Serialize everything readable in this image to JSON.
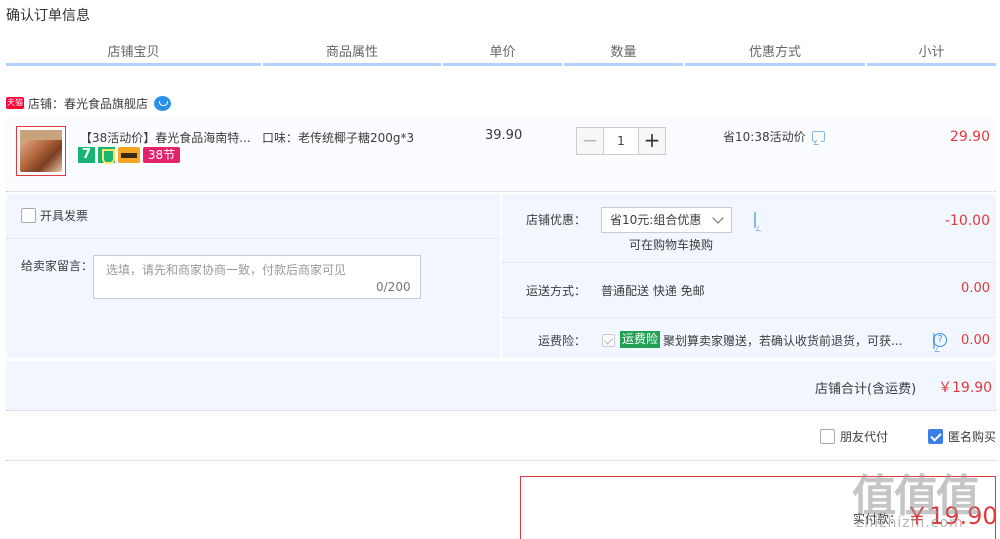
{
  "page": {
    "title": "确认订单信息"
  },
  "columns": [
    {
      "label": "店铺宝贝"
    },
    {
      "label": "商品属性"
    },
    {
      "label": "单价"
    },
    {
      "label": "数量"
    },
    {
      "label": "优惠方式"
    },
    {
      "label": "小计"
    }
  ],
  "shop": {
    "badge": "天猫",
    "label": "店铺：春光食品旗舰店"
  },
  "item": {
    "title": "【38活动价】春光食品海南特...",
    "badges": {
      "seven": "7",
      "festival": "38节"
    },
    "attribute": "口味：老传统椰子糖200g*3",
    "price": "39.90",
    "quantity": "1",
    "minus": "−",
    "plus": "+",
    "promo": "省10:38活动价",
    "subtotal": "29.90"
  },
  "options": {
    "invoice_label": "开具发票",
    "message_label": "给卖家留言：",
    "message_placeholder": "选填，请先和商家协商一致，付款后商家可见",
    "message_count": "0/200",
    "shop_discount_label": "店铺优惠：",
    "shop_discount_selected": "省10元:组合优惠",
    "cart_hint": "可在购物车换购",
    "shop_discount_value": "-10.00",
    "shipping_label": "运送方式：",
    "shipping_value": "普通配送 快递 免邮",
    "shipping_amount": "0.00",
    "insurance_label": "运费险：",
    "insurance_badge": "运费险",
    "insurance_text": "聚划算卖家赠送，若确认收货前退货，可获...",
    "help_glyph": "?",
    "insurance_amount": "0.00"
  },
  "totals": {
    "shop_total_label": "店铺合计(含运费)",
    "shop_total_value": "￥19.90"
  },
  "extras": {
    "friend_pay_label": "朋友代付",
    "anonymous_label": "匿名购买",
    "anonymous_checked": true
  },
  "payment": {
    "label": "实付款：",
    "value": "￥19.90"
  },
  "watermark": {
    "main": "值值值",
    "sub": "zhizhizhi.com"
  },
  "colors": {
    "accent_red": "#e4393c",
    "border_blue": "#b2d1ff",
    "panel_bg": "#f2f7ff",
    "insurance_green": "#22a155",
    "tmall_red": "#ff0036"
  }
}
